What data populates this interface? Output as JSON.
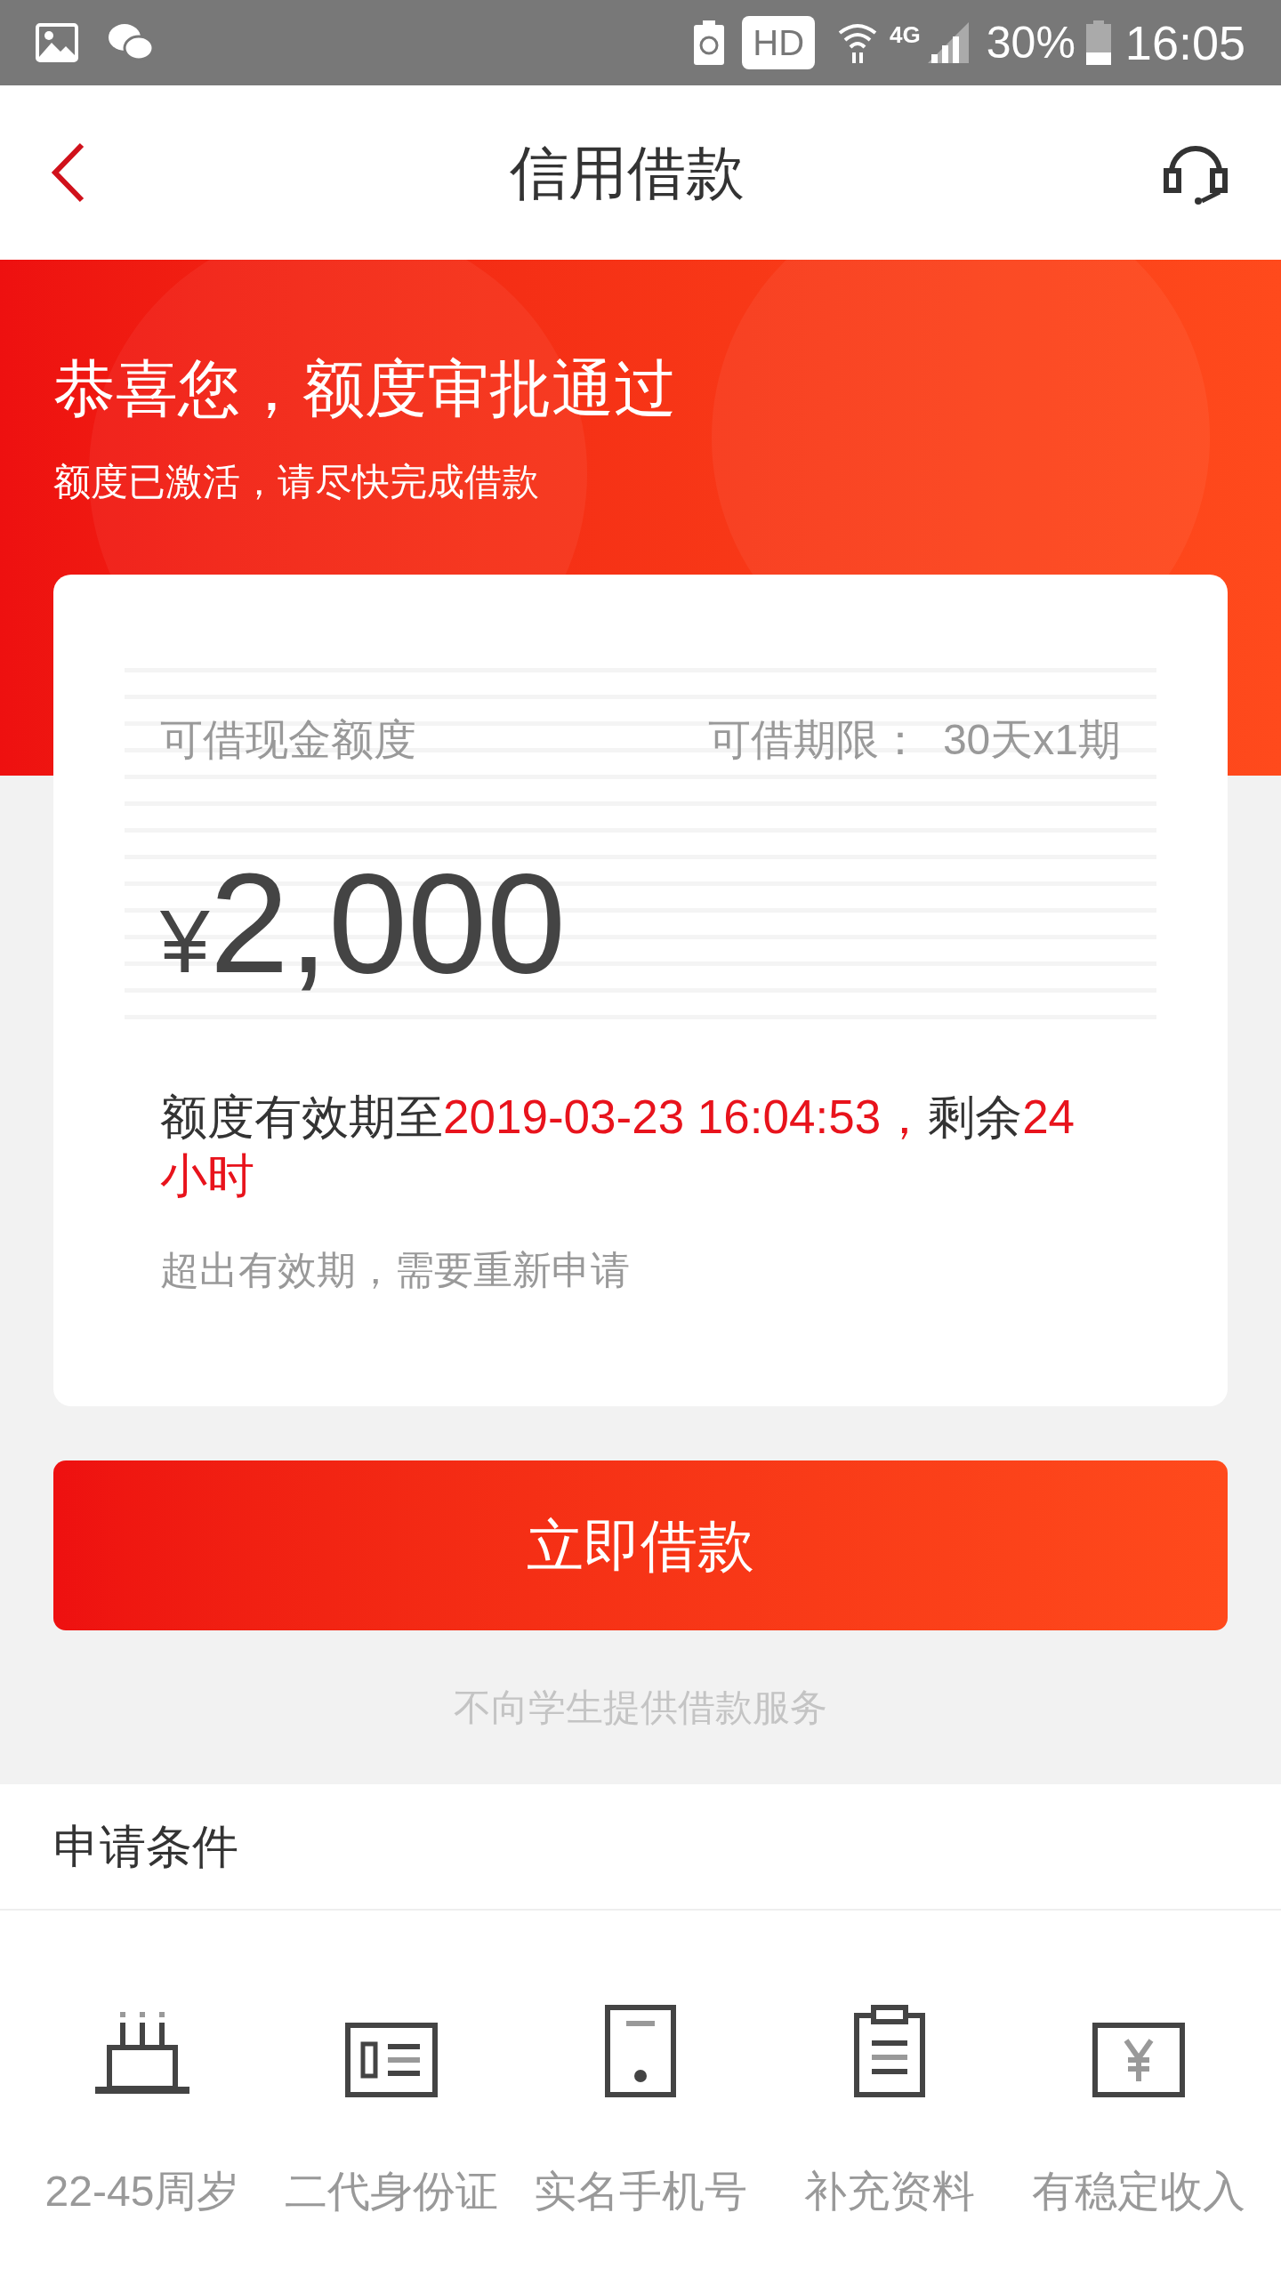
{
  "status_bar": {
    "hd": "HD",
    "network": "4G",
    "battery": "30%",
    "time": "16:05"
  },
  "header": {
    "title": "信用借款"
  },
  "banner": {
    "title": "恭喜您，额度审批通过",
    "subtitle": "额度已激活，请尽快完成借款"
  },
  "card": {
    "amount_label": "可借现金额度",
    "term_label": "可借期限：",
    "term_value": "30天x1期",
    "currency": "¥",
    "amount": "2,000",
    "validity": [
      {
        "text": "额度有效期至",
        "highlight": false
      },
      {
        "text": "2019-03-23 16:04:53，",
        "highlight": true
      },
      {
        "text": "剩余",
        "highlight": false
      },
      {
        "text": "24小时",
        "highlight": true
      }
    ],
    "note": "超出有效期，需要重新申请"
  },
  "borrow_button": "立即借款",
  "disclaimer": "不向学生提供借款服务",
  "conditions": {
    "title": "申请条件",
    "items": [
      {
        "kind": "cake",
        "label": "22-45周岁"
      },
      {
        "kind": "id",
        "label": "二代身份证"
      },
      {
        "kind": "phone",
        "label": "实名手机号"
      },
      {
        "kind": "clipboard",
        "label": "补充资料"
      },
      {
        "kind": "income",
        "label": "有稳定收入"
      }
    ]
  }
}
